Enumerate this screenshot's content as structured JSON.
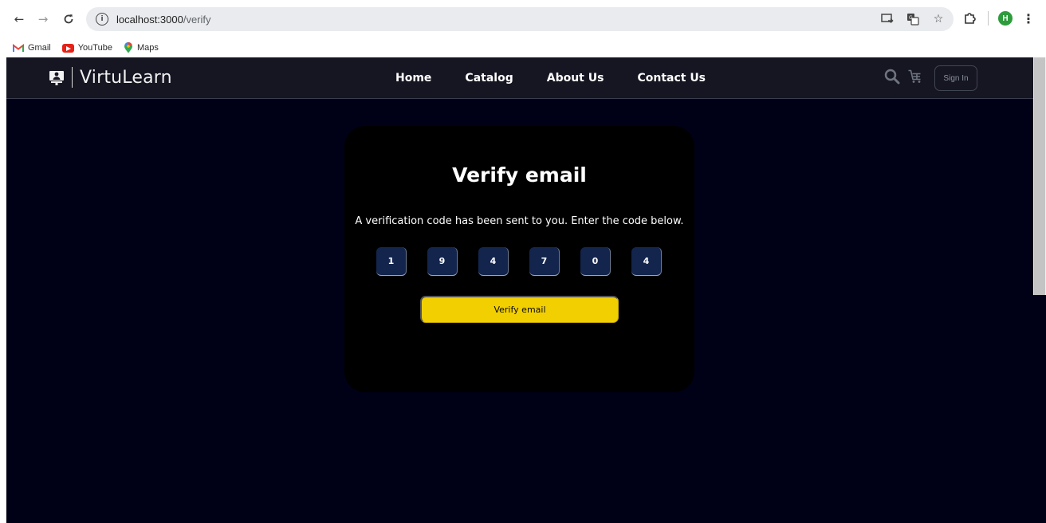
{
  "browser": {
    "url_host": "localhost:3000",
    "url_path": "/verify",
    "profile_initial": "H",
    "bookmarks": [
      {
        "label": "Gmail",
        "icon": "gmail-icon"
      },
      {
        "label": "YouTube",
        "icon": "youtube-icon"
      },
      {
        "label": "Maps",
        "icon": "maps-icon"
      }
    ]
  },
  "site": {
    "brand": "VirtuLearn",
    "nav": [
      {
        "label": "Home"
      },
      {
        "label": "Catalog"
      },
      {
        "label": "About Us"
      },
      {
        "label": "Contact Us"
      }
    ],
    "sign_in_label": "Sign In"
  },
  "verify": {
    "title": "Verify email",
    "description": "A verification code has been sent to you. Enter the code below.",
    "code_digits": [
      "1",
      "9",
      "4",
      "7",
      "0",
      "4"
    ],
    "button_label": "Verify email"
  },
  "colors": {
    "page_background": "#000017",
    "header_background": "#161622",
    "card_background": "#000000",
    "otp_box": "#13254d",
    "accent_button": "#f2cf00"
  }
}
